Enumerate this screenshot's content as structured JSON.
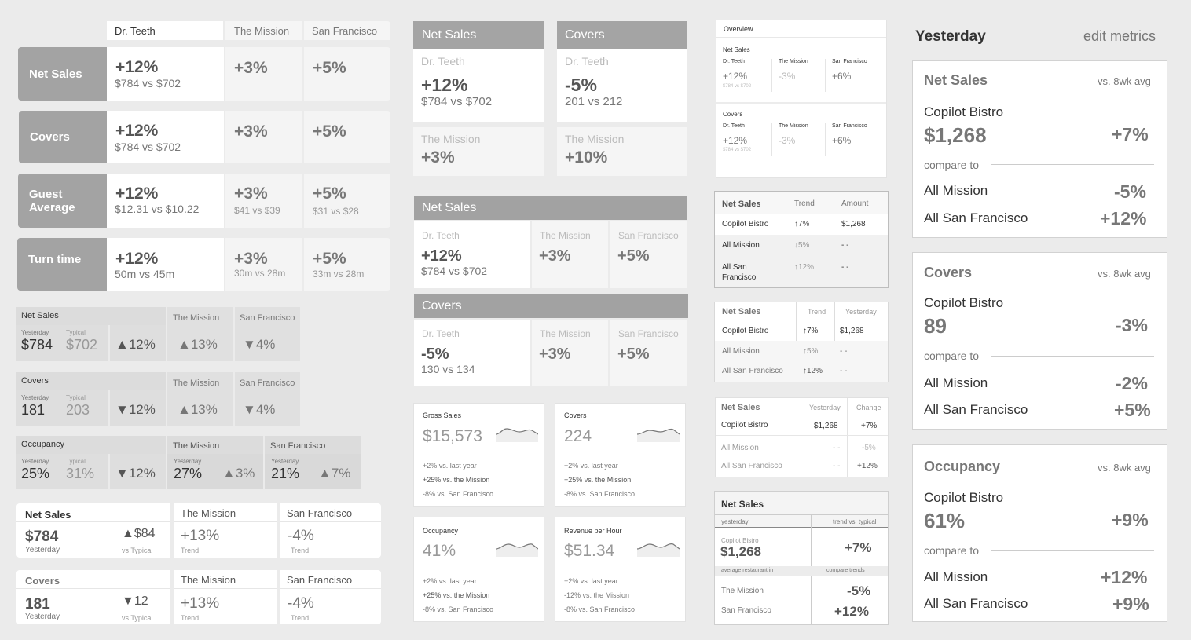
{
  "col1_top": {
    "headers": [
      "Dr. Teeth",
      "The Mission",
      "San Francisco"
    ],
    "rows": [
      {
        "label": "Net Sales",
        "main_big": "+12%",
        "main_sub": "$784 vs $702",
        "c2_big": "+3%",
        "c2_sub": "",
        "c3_big": "+5%",
        "c3_sub": ""
      },
      {
        "label": "Covers",
        "main_big": "+12%",
        "main_sub": "$784 vs $702",
        "c2_big": "+3%",
        "c2_sub": "",
        "c3_big": "+5%",
        "c3_sub": ""
      },
      {
        "label": "Guest Average",
        "main_big": "+12%",
        "main_sub": "$12.31 vs $10.22",
        "c2_big": "+3%",
        "c2_sub": "$41 vs $39",
        "c3_big": "+5%",
        "c3_sub": "$31 vs $28"
      },
      {
        "label": "Turn time",
        "main_big": "+12%",
        "main_sub": "50m vs 45m",
        "c2_big": "+3%",
        "c2_sub": "30m vs 28m",
        "c3_big": "+5%",
        "c3_sub": "33m vs 28m"
      }
    ]
  },
  "col1_mid": [
    {
      "title": "Net Sales",
      "h2": "The Mission",
      "h3": "San Francisco",
      "lbl_y": "Yesterday",
      "val_y": "$784",
      "lbl_t": "Typical",
      "val_t": "$702",
      "chg": "▲12%",
      "c2": "▲13%",
      "c3": "▼4%"
    },
    {
      "title": "Covers",
      "h2": "The Mission",
      "h3": "San Francisco",
      "lbl_y": "Yesterday",
      "val_y": "181",
      "lbl_t": "Typical",
      "val_t": "203",
      "chg": "▼12%",
      "c2": "▲13%",
      "c3": "▼4%"
    }
  ],
  "col1_occ": {
    "title": "Occupancy",
    "lbl_y": "Yesterday",
    "val_y": "25%",
    "lbl_t": "Typical",
    "val_t": "31%",
    "chg": "▼12%",
    "m_title": "The Mission",
    "m_lbl": "Yesterday",
    "m_val": "27%",
    "m_chg": "▲3%",
    "s_title": "San Francisco",
    "s_lbl": "Yesterday",
    "s_val": "21%",
    "s_chg": "▲7%"
  },
  "col1_bottom": [
    {
      "title": "Net Sales",
      "val": "$784",
      "val_lbl": "Yesterday",
      "chg": "▲$84",
      "chg_lbl": "vs Typical",
      "m_title": "The Mission",
      "m_val": "+13%",
      "m_lbl": "Trend",
      "s_title": "San Francisco",
      "s_val": "-4%",
      "s_lbl": "Trend"
    },
    {
      "title": "Covers",
      "val": "181",
      "val_lbl": "Yesterday",
      "chg": "▼12",
      "chg_lbl": "vs Typical",
      "m_title": "The Mission",
      "m_val": "+13%",
      "m_lbl": "Trend",
      "s_title": "San Francisco",
      "s_val": "-4%",
      "s_lbl": "Trend"
    }
  ],
  "col2_top": [
    {
      "title": "Net Sales",
      "loc1": "Dr. Teeth",
      "big1": "+12%",
      "sub1": "$784 vs $702",
      "loc2": "The Mission",
      "big2": "+3%"
    },
    {
      "title": "Covers",
      "loc1": "Dr. Teeth",
      "big1": "-5%",
      "sub1": "201 vs 212",
      "loc2": "The Mission",
      "big2": "+10%"
    }
  ],
  "col2_sections": [
    {
      "title": "Net Sales",
      "c1_lbl": "Dr. Teeth",
      "c1_big": "+12%",
      "c1_sub": "$784 vs $702",
      "c2_lbl": "The Mission",
      "c2_big": "+3%",
      "c3_lbl": "San Francisco",
      "c3_big": "+5%"
    },
    {
      "title": "Covers",
      "c1_lbl": "Dr. Teeth",
      "c1_big": "-5%",
      "c1_sub": "130 vs 134",
      "c2_lbl": "The Mission",
      "c2_big": "+3%",
      "c3_lbl": "San Francisco",
      "c3_big": "+5%"
    }
  ],
  "col2_cards": [
    {
      "title": "Gross Sales",
      "value": "$15,573",
      "l1": "+2% vs. last year",
      "l2": "+25% vs. the Mission",
      "l3": "-8% vs. San Francisco"
    },
    {
      "title": "Covers",
      "value": "224",
      "l1": "+2% vs. last year",
      "l2": "+25% vs. the Mission",
      "l3": "-8% vs. San Francisco"
    },
    {
      "title": "Occupancy",
      "value": "41%",
      "l1": "+2% vs. last year",
      "l2": "+25% vs. the Mission",
      "l3": "-8% vs. San Francisco"
    },
    {
      "title": "Revenue per Hour",
      "value": "$51.34",
      "l1": "+2% vs. last year",
      "l2": "-12% vs. the Mission",
      "l3": "-8% vs. San Francisco"
    }
  ],
  "col3_overview": {
    "title": "Overview",
    "blocks": [
      {
        "name": "Net Sales",
        "h1": "Dr. Teeth",
        "h2": "The Mission",
        "h3": "San Francisco",
        "v1": "+12%",
        "s1": "$784 vs $702",
        "v2": "-3%",
        "v3": "+6%"
      },
      {
        "name": "Covers",
        "h1": "Dr. Teeth",
        "h2": "The Mission",
        "h3": "San Francisco",
        "v1": "+12%",
        "s1": "$784 vs $702",
        "v2": "-3%",
        "v3": "+6%"
      }
    ]
  },
  "col3_table1": {
    "h": [
      "Net Sales",
      "Trend",
      "Amount"
    ],
    "rows": [
      [
        "Copilot Bistro",
        "↑7%",
        "$1,268"
      ],
      [
        "All Mission",
        "↓5%",
        "- -"
      ],
      [
        "All San Francisco",
        "↑12%",
        "- -"
      ]
    ]
  },
  "col3_table2": {
    "h": [
      "Net Sales",
      "Trend",
      "Yesterday"
    ],
    "rows": [
      [
        "Copilot Bistro",
        "↑7%",
        "$1,268"
      ],
      [
        "All Mission",
        "↑5%",
        "- -"
      ],
      [
        "All San Francisco",
        "↑12%",
        "- -"
      ]
    ]
  },
  "col3_table3": {
    "h": [
      "Net Sales",
      "Yesterday",
      "Change"
    ],
    "rows": [
      [
        "Copilot Bistro",
        "$1,268",
        "+7%"
      ],
      [
        "All Mission",
        "- -",
        "-5%"
      ],
      [
        "All San Francisco",
        "- -",
        "+12%"
      ]
    ]
  },
  "col3_table4": {
    "title": "Net Sales",
    "sub_l": "yesterday",
    "sub_r": "trend vs. typical",
    "rest": "Copilot Bistro",
    "rest_val": "$1,268",
    "rest_chg": "+7%",
    "avg_l": "average restaurant in",
    "avg_r": "compare trends",
    "r1": "The Mission",
    "r1v": "-5%",
    "r2": "San Francisco",
    "r2v": "+12%"
  },
  "col4": {
    "title": "Yesterday",
    "edit": "edit metrics",
    "cards": [
      {
        "metric": "Net Sales",
        "cmp": "vs. 8wk avg",
        "rest": "Copilot Bistro",
        "value": "$1,268",
        "chg": "+7%",
        "compare": "compare to",
        "r1": "All Mission",
        "r1v": "-5%",
        "r2": "All San Francisco",
        "r2v": "+12%"
      },
      {
        "metric": "Covers",
        "cmp": "vs. 8wk avg",
        "rest": "Copilot Bistro",
        "value": "89",
        "chg": "-3%",
        "compare": "compare to",
        "r1": "All Mission",
        "r1v": "-2%",
        "r2": "All San Francisco",
        "r2v": "+5%"
      },
      {
        "metric": "Occupancy",
        "cmp": "vs. 8wk avg",
        "rest": "Copilot Bistro",
        "value": "61%",
        "chg": "+9%",
        "compare": "compare to",
        "r1": "All Mission",
        "r1v": "+12%",
        "r2": "All San Francisco",
        "r2v": "+9%"
      }
    ]
  }
}
